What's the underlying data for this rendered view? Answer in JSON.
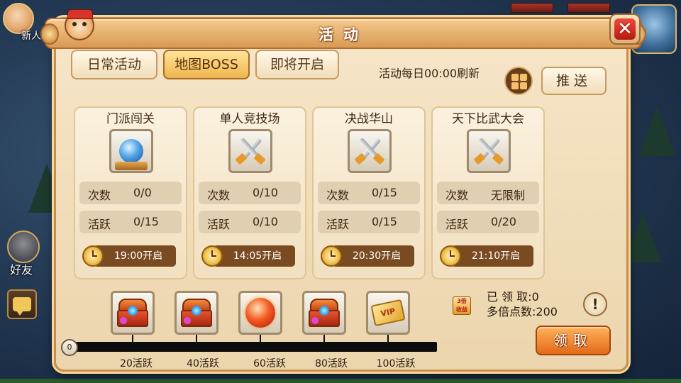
{
  "hud": {
    "newbie_label": "新人",
    "friend_label": "好友"
  },
  "panel": {
    "title": "活动"
  },
  "tabs": [
    {
      "label": "日常活动",
      "active": false
    },
    {
      "label": "地图BOSS",
      "active": true
    },
    {
      "label": "即将开启",
      "active": false
    }
  ],
  "refresh_text": "活动每日00:00刷新",
  "push_label": "推送",
  "cards": [
    {
      "title": "门派闯关",
      "icon": "crystal-orb-icon",
      "count_label": "次数",
      "count_value": "0/0",
      "active_label": "活跃",
      "active_value": "0/15",
      "open_time": "19:00开启"
    },
    {
      "title": "单人竞技场",
      "icon": "crossed-swords-icon",
      "count_label": "次数",
      "count_value": "0/10",
      "active_label": "活跃",
      "active_value": "0/10",
      "open_time": "14:05开启"
    },
    {
      "title": "决战华山",
      "icon": "crossed-swords-icon",
      "count_label": "次数",
      "count_value": "0/15",
      "active_label": "活跃",
      "active_value": "0/15",
      "open_time": "20:30开启"
    },
    {
      "title": "天下比武大会",
      "icon": "crossed-swords-icon",
      "count_label": "次数",
      "count_value": "无限制",
      "active_label": "活跃",
      "active_value": "0/20",
      "open_time": "21:10开启"
    }
  ],
  "rewards": {
    "current_activity": "0",
    "progress_fraction": 0,
    "milestones": [
      {
        "label": "20活跃",
        "icon": "treasure-chest-icon"
      },
      {
        "label": "40活跃",
        "icon": "treasure-chest-icon"
      },
      {
        "label": "60活跃",
        "icon": "fire-orb-icon"
      },
      {
        "label": "80活跃",
        "icon": "treasure-chest-icon"
      },
      {
        "label": "100活跃",
        "icon": "vip-card-icon"
      }
    ]
  },
  "claim": {
    "claimed_text": "已 领 取:0",
    "multiplier_text": "多倍点数:200",
    "bonus_icon_text": "3倍\n收益",
    "info_label": "!",
    "claim_button": "领取"
  },
  "colors": {
    "panel_bg": "#f6e6c9",
    "title_bar": "#d99a55",
    "active_tab": "#eeb54e",
    "timer_bg": "#7a4a21",
    "claim_button": "#e36a1a"
  }
}
